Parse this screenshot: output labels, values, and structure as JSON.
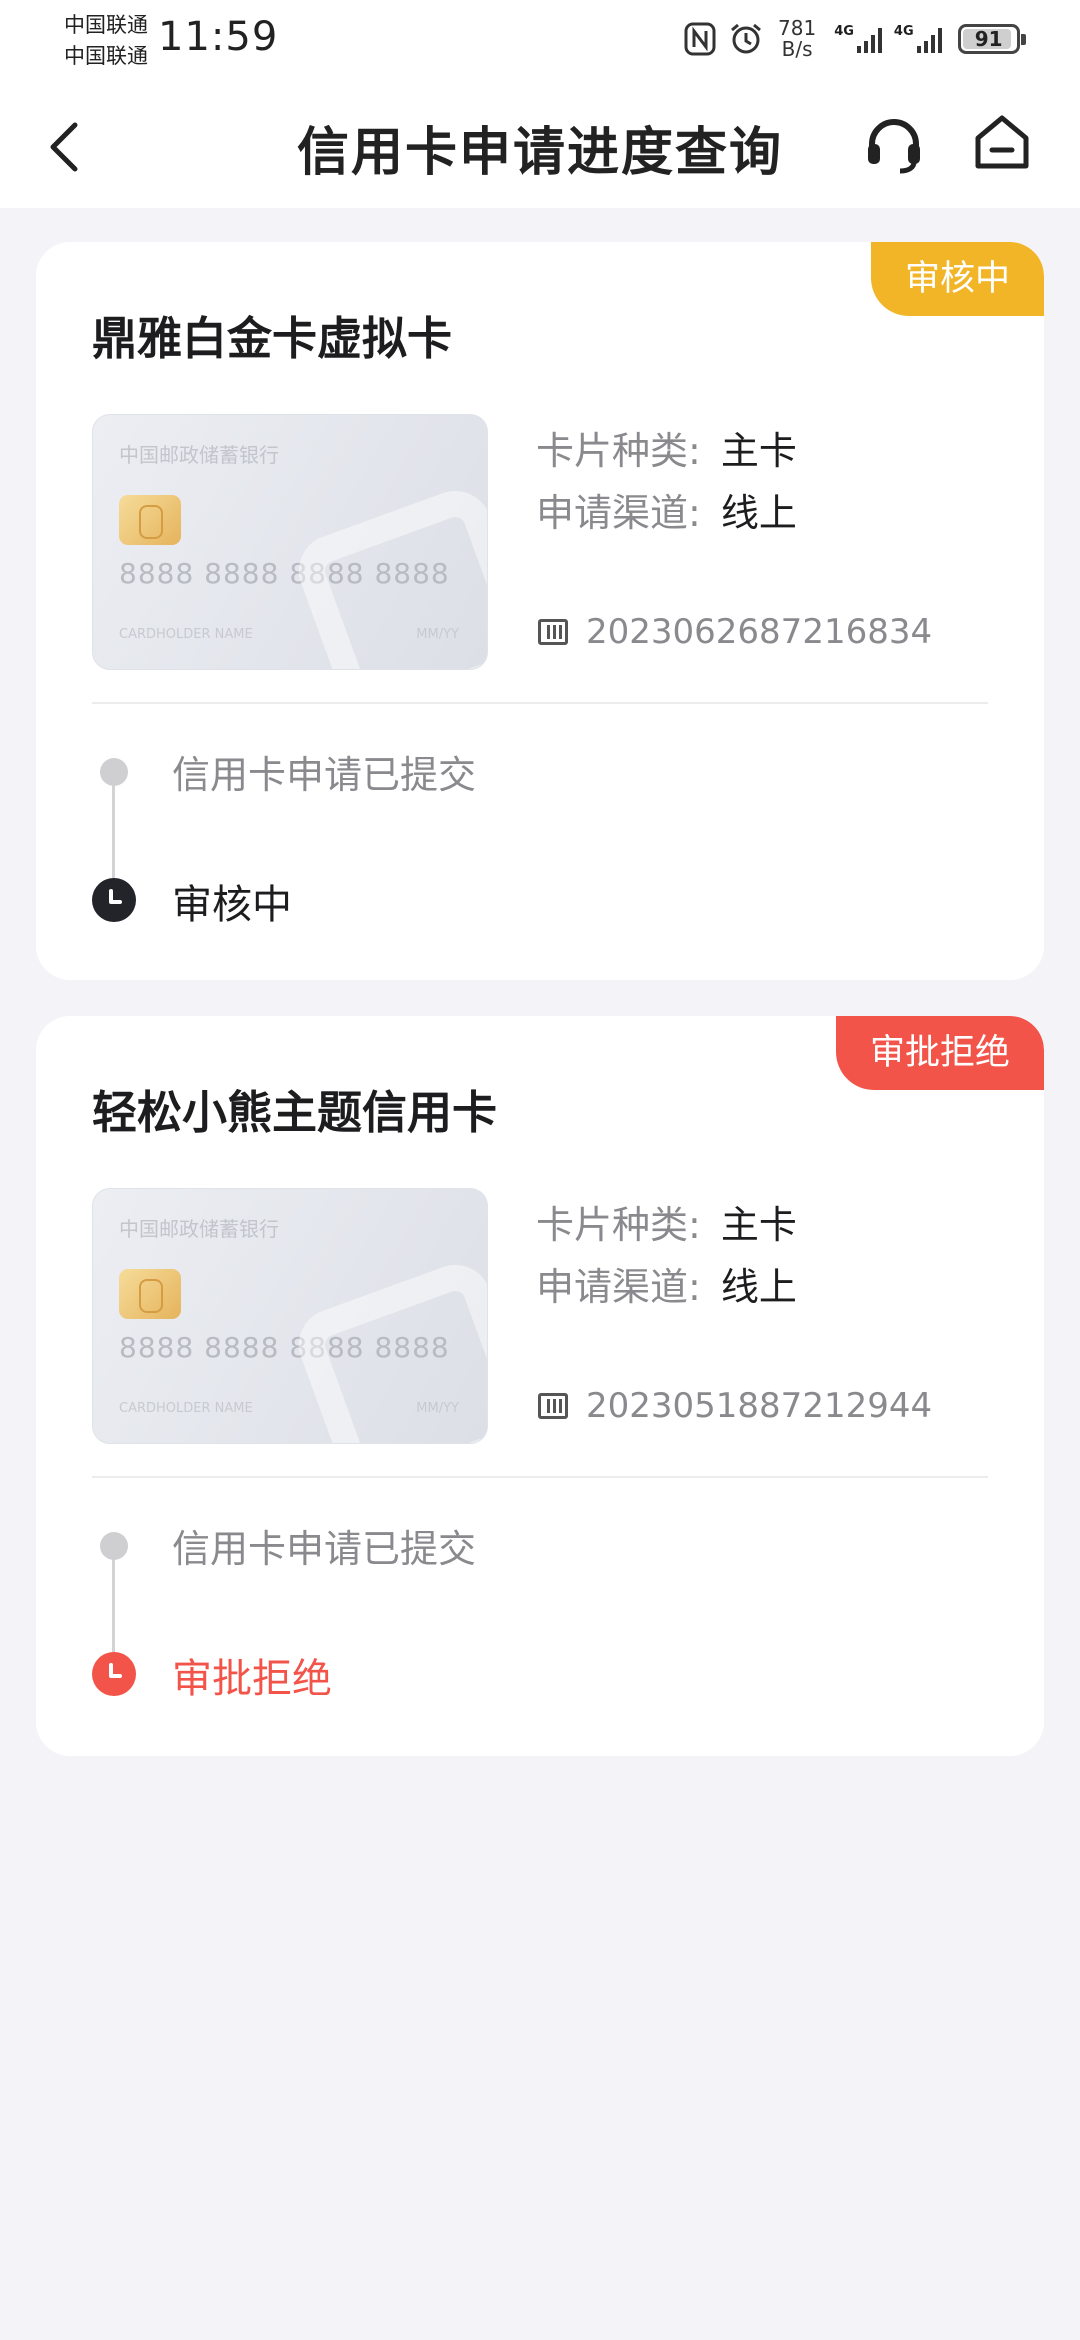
{
  "status_bar": {
    "carrier_1": "中国联通",
    "carrier_2": "中国联通",
    "time": "11:59",
    "net_speed_value": "781",
    "net_speed_unit": "B/s",
    "network_1": "4G",
    "network_2": "4G",
    "battery": "91",
    "icons": [
      "nfc-icon",
      "alarm-icon",
      "signal-icon",
      "battery-icon"
    ]
  },
  "nav": {
    "title": "信用卡申请进度查询",
    "icons": [
      "back-arrow-icon",
      "headset-icon",
      "home-icon"
    ]
  },
  "applications": [
    {
      "status_tag": "审核中",
      "status_color": "#f1b527",
      "card_name": "鼎雅白金卡虚拟卡",
      "card_image": {
        "bank_name": "中国邮政储蓄银行",
        "number": "8888 8888 8888 8888",
        "holder": "CARDHOLDER NAME",
        "expiry": "MM/YY"
      },
      "card_type_label": "卡片种类:",
      "card_type_value": "主卡",
      "channel_label": "申请渠道:",
      "channel_value": "线上",
      "application_no": "2023062687216834",
      "timeline": {
        "step1": "信用卡申请已提交",
        "step2": "审核中"
      }
    },
    {
      "status_tag": "审批拒绝",
      "status_color": "#f3544a",
      "card_name": "轻松小熊主题信用卡",
      "card_image": {
        "bank_name": "中国邮政储蓄银行",
        "number": "8888 8888 8888 8888",
        "holder": "CARDHOLDER NAME",
        "expiry": "MM/YY"
      },
      "card_type_label": "卡片种类:",
      "card_type_value": "主卡",
      "channel_label": "申请渠道:",
      "channel_value": "线上",
      "application_no": "2023051887212944",
      "timeline": {
        "step1": "信用卡申请已提交",
        "step2": "审批拒绝"
      }
    }
  ]
}
